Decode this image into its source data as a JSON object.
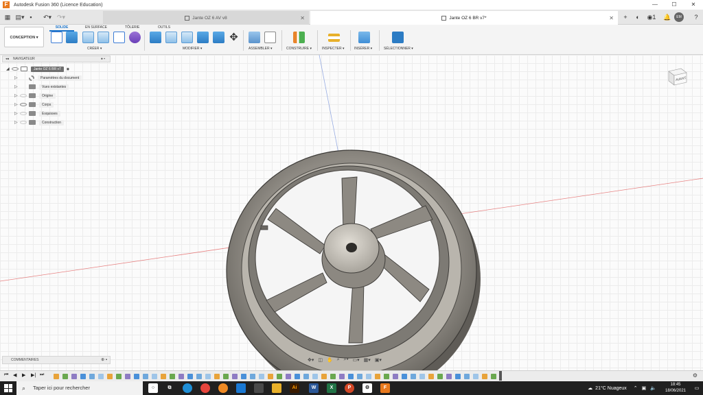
{
  "window": {
    "title": "Autodesk Fusion 360 (Licence Education)",
    "logo": "F",
    "controls": [
      "—",
      "☐",
      "✕"
    ]
  },
  "tabs": {
    "inactive": "Jante OZ 6 AV v8",
    "active": "Jante OZ 6 BR v7*",
    "close": "✕",
    "add": "+",
    "notif_count": "1",
    "avatar": "EM"
  },
  "ribbon": {
    "workspace": "CONCEPTION ▾",
    "tabs": [
      "SOLIDE",
      "EN SURFACE",
      "TÔLERIE",
      "OUTILS"
    ],
    "groups": [
      "CRÉER ▾",
      "MODIFIER ▾",
      "ASSEMBLER ▾",
      "CONSTRUIRE ▾",
      "INSPECTER ▾",
      "INSÉRER ▾",
      "SÉLECTIONNER ▾"
    ]
  },
  "navigator": {
    "title": "NAVIGATEUR",
    "root": "Jante OZ 6 BR v7",
    "items": [
      "Paramètres du document",
      "Vues existantes",
      "Origine",
      "Corps",
      "Esquisses",
      "Construction"
    ]
  },
  "viewcube": {
    "face": "AVANT"
  },
  "comments": {
    "label": "COMMENTAIRES"
  },
  "taskbar": {
    "search_placeholder": "Taper ici pour rechercher",
    "weather": "21°C  Nuageux",
    "time": "18:45",
    "date": "18/06/2021"
  },
  "colors": {
    "accent": "#1a73c9",
    "model_body": "#8e8a83",
    "model_light": "#c9c5bc",
    "axis_red": "#e05050",
    "axis_blue": "#6d8bd8"
  }
}
